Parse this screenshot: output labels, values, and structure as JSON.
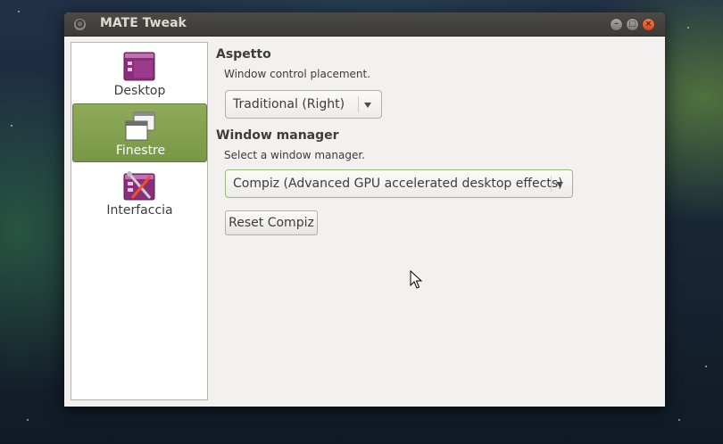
{
  "window": {
    "title": "MATE Tweak",
    "controls": {
      "minimize": "–",
      "maximize": "▢",
      "close": "×"
    }
  },
  "sidebar": {
    "items": [
      {
        "label": "Desktop",
        "icon": "desktop-icon",
        "selected": false
      },
      {
        "label": "Finestre",
        "icon": "windows-icon",
        "selected": true
      },
      {
        "label": "Interfaccia",
        "icon": "interface-icon",
        "selected": false
      }
    ]
  },
  "main": {
    "aspetto": {
      "heading": "Aspetto",
      "description": "Window control placement.",
      "combo_value": "Traditional (Right)"
    },
    "window_manager": {
      "heading": "Window manager",
      "description": "Select a window manager.",
      "combo_value": "Compiz (Advanced GPU accelerated desktop effects)",
      "reset_label": "Reset Compiz"
    }
  },
  "colors": {
    "accent": "#7f9f4c",
    "titlebar": "#3c3b37",
    "close_button": "#e95420"
  }
}
